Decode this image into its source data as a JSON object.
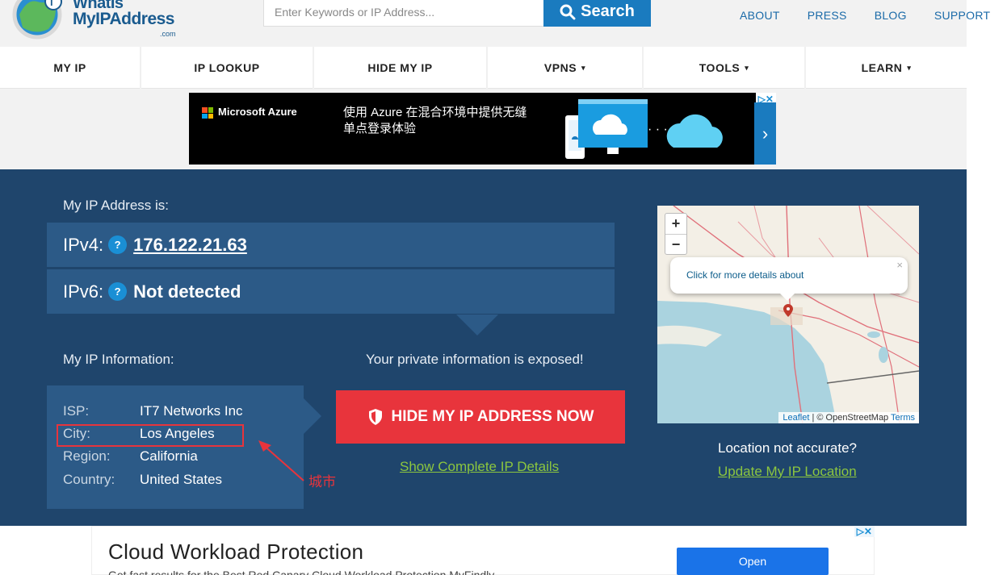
{
  "header": {
    "logo": {
      "line1": "WhatIs",
      "line2": "MyIPAddress",
      "line3": ".com"
    },
    "search_placeholder": "Enter Keywords or IP Address...",
    "search_button": "Search",
    "links": [
      "ABOUT",
      "PRESS",
      "BLOG",
      "SUPPORT"
    ]
  },
  "nav": {
    "items": [
      {
        "label": "MY IP",
        "caret": ""
      },
      {
        "label": "IP LOOKUP",
        "caret": ""
      },
      {
        "label": "HIDE MY IP",
        "caret": ""
      },
      {
        "label": "VPNS",
        "caret": "▾"
      },
      {
        "label": "TOOLS",
        "caret": "▾"
      },
      {
        "label": "LEARN",
        "caret": "▾"
      }
    ]
  },
  "ad_banner": {
    "brand": "Microsoft Azure",
    "text": "使用 Azure 在混合环境中提供无缝单点登录体验",
    "arrow": "›"
  },
  "main": {
    "my_ip_label": "My IP Address is:",
    "ipv4_label": "IPv4:",
    "ipv4_value": "176.122.21.63",
    "ipv6_label": "IPv6:",
    "ipv6_value": "Not detected",
    "help_glyph": "?",
    "info_label": "My IP Information:",
    "exposed_text": "Your private information is exposed!",
    "info": [
      {
        "key": "ISP:",
        "value": "IT7 Networks Inc"
      },
      {
        "key": "City:",
        "value": "Los Angeles"
      },
      {
        "key": "Region:",
        "value": "California"
      },
      {
        "key": "Country:",
        "value": "United States"
      }
    ],
    "cta_button": "HIDE MY IP ADDRESS NOW",
    "details_link": "Show Complete IP Details",
    "map": {
      "zoom_in": "+",
      "zoom_out": "−",
      "popup_text": "Click for more details about",
      "popup_close": "×",
      "attribution_leaflet": "Leaflet",
      "attribution_mid": " | © OpenStreetMap ",
      "attribution_terms": "Terms"
    },
    "location_question": "Location not accurate?",
    "update_link": "Update My IP Location"
  },
  "annotation": {
    "label": "城市",
    "color": "#e8343c"
  },
  "bottom_ad": {
    "title": "Cloud Workload Protection",
    "subtitle": "Get fast results for the Best Red Canary Cloud Workload Protection MyFindly",
    "button": "Open"
  },
  "colors": {
    "main_bg": "#1f456c",
    "row_bg": "#2c5a87",
    "cta": "#e8343c",
    "link_green": "#8cc63f",
    "brand_blue": "#1a7bbf"
  }
}
